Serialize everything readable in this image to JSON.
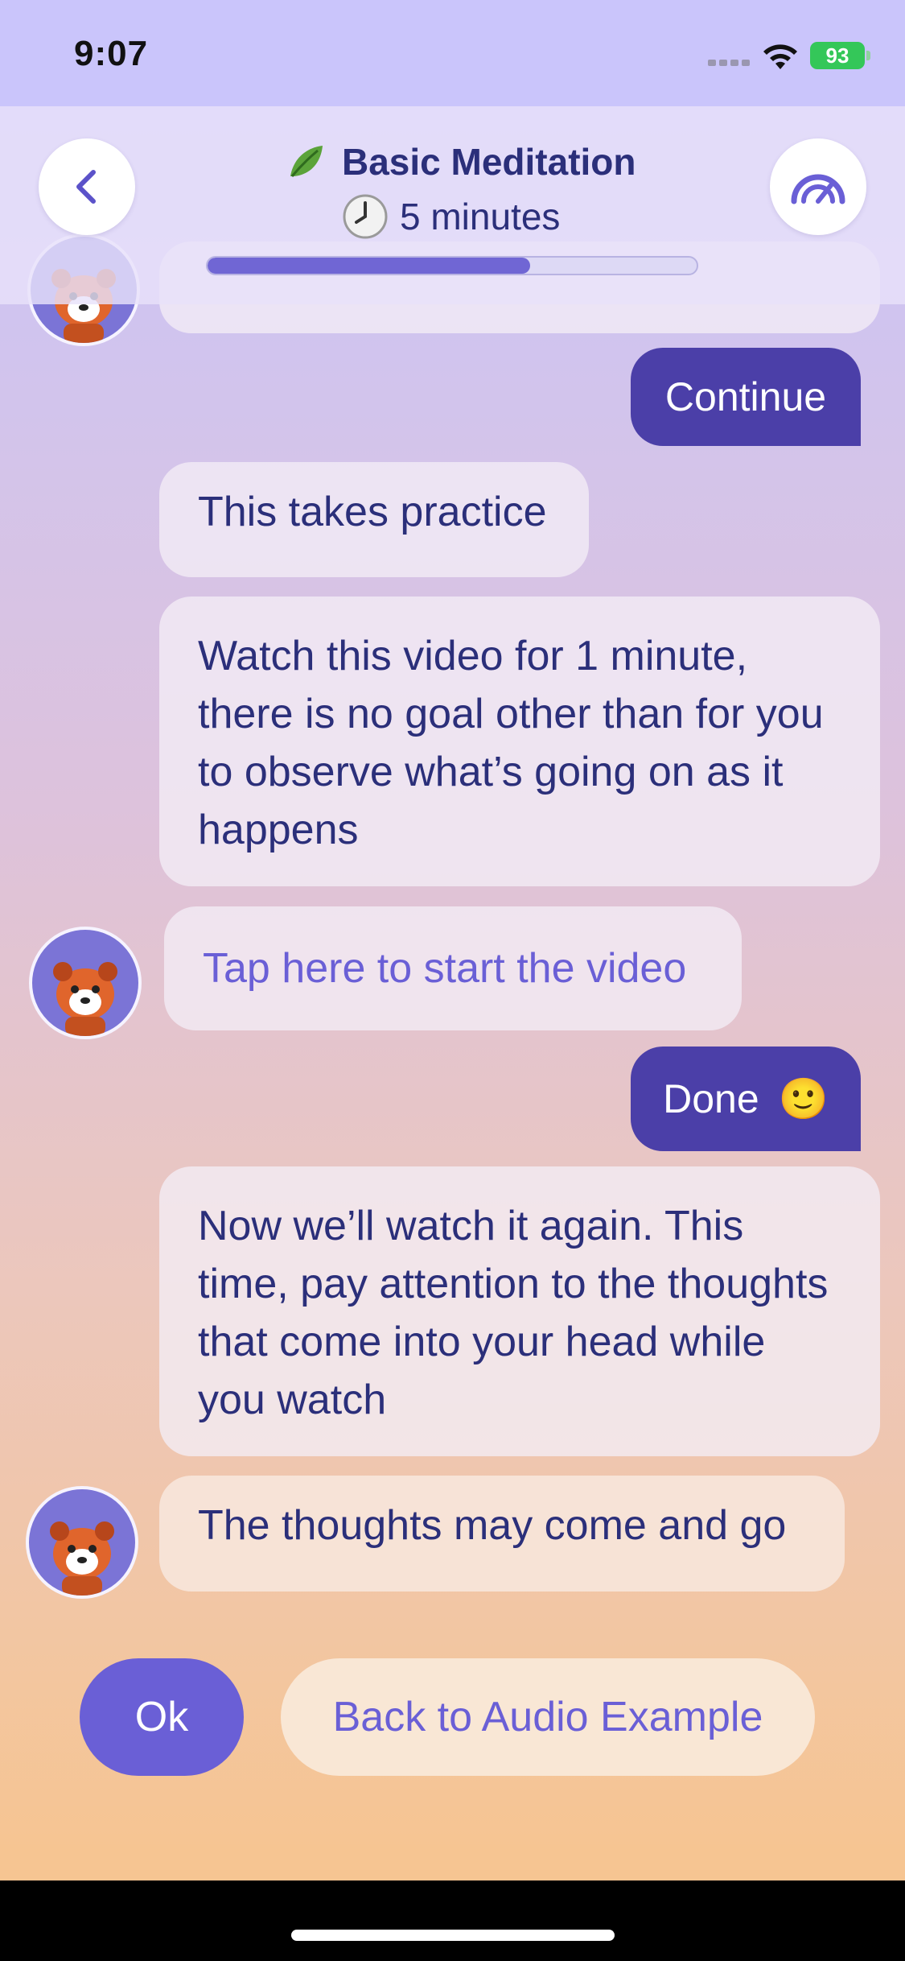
{
  "status_bar": {
    "time": "9:07",
    "battery": "93"
  },
  "header": {
    "title": "Basic Meditation",
    "title_icon": "leaf-icon",
    "duration": "5 minutes",
    "duration_icon": "clock-icon",
    "progress": 0.66
  },
  "messages": {
    "continue_reply": "Continue",
    "m1": "This takes practice",
    "m2": "Watch this video for 1 minute, there is no goal other than for you to observe what’s going on as it happens",
    "video_link": "Tap here to start the video",
    "done_reply": "Done",
    "done_emoji": "🙂",
    "m3": "Now we’ll watch it again. This time, pay attention to the thoughts that come into your head while you watch",
    "m4": "The thoughts may come and go"
  },
  "actions": {
    "ok_label": "Ok",
    "audio_label": "Back to Audio Example"
  },
  "colors": {
    "accent": "#6a5fd6",
    "user_bubble": "#4b3fa8",
    "text": "#2b2f7a"
  }
}
